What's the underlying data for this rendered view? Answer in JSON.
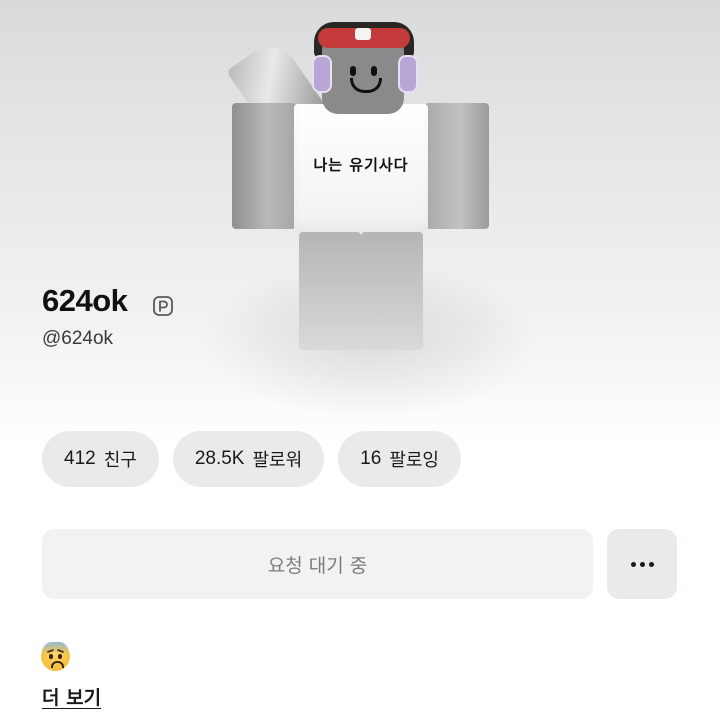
{
  "profile": {
    "display_name": "624ok",
    "username": "@624ok",
    "avatar_shirt_text": "나는 유기사다"
  },
  "stats": [
    {
      "value": "412",
      "label": "친구"
    },
    {
      "value": "28.5K",
      "label": "팔로워"
    },
    {
      "value": "16",
      "label": "팔로잉"
    }
  ],
  "actions": {
    "pending_label": "요청 대기 중",
    "more_icon": "ellipsis-icon"
  },
  "bio": {
    "emoji": "anxious-face-with-sweat",
    "see_more_label": "더 보기"
  },
  "icons": {
    "premium": "premium-badge-icon"
  },
  "colors": {
    "pill_bg": "#e9eaec",
    "pending_bg": "#f2f2f3",
    "pending_text": "#7b7d80"
  }
}
